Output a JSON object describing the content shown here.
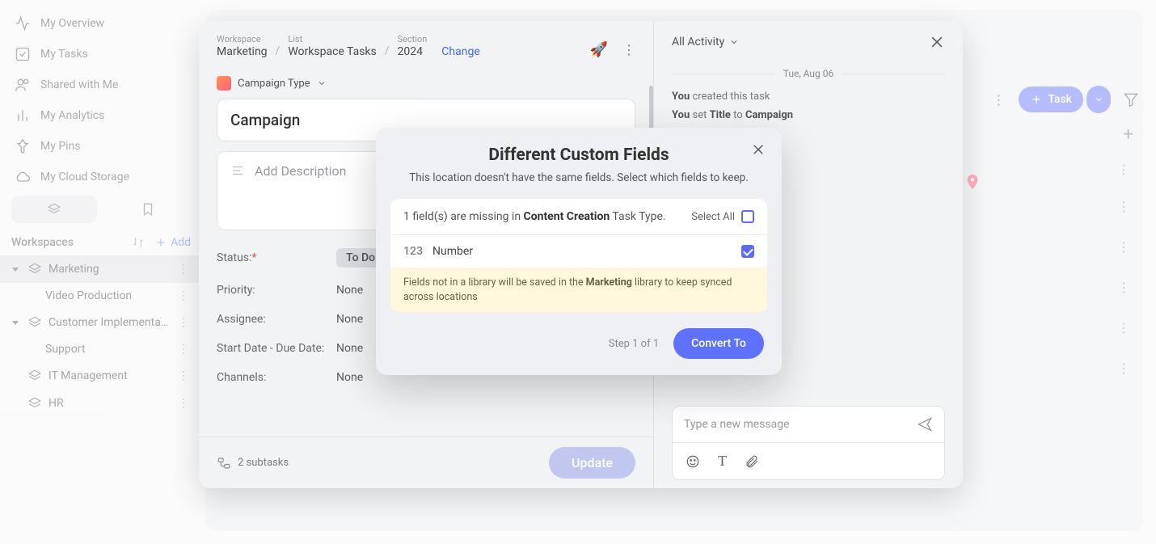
{
  "sidebar": {
    "nav": [
      {
        "label": "My Overview",
        "icon": "activity"
      },
      {
        "label": "My Tasks",
        "icon": "check-square"
      },
      {
        "label": "Shared with Me",
        "icon": "users"
      },
      {
        "label": "My Analytics",
        "icon": "bar-chart"
      },
      {
        "label": "My Pins",
        "icon": "pin"
      },
      {
        "label": "My Cloud Storage",
        "icon": "cloud"
      }
    ],
    "ws_label": "Workspaces",
    "add_label": "Add",
    "tree": [
      {
        "label": "Marketing",
        "active": true,
        "children": [
          {
            "label": "Video Production"
          }
        ]
      },
      {
        "label": "Customer Implementa…",
        "children": [
          {
            "label": "Support"
          }
        ]
      },
      {
        "label": "IT Management"
      },
      {
        "label": "HR"
      }
    ]
  },
  "board": {
    "task_btn": "Task"
  },
  "drawer": {
    "breadcrumb": {
      "workspace_lab": "Workspace",
      "workspace": "Marketing",
      "list_lab": "List",
      "list": "Workspace Tasks",
      "section_lab": "Section",
      "section": "2024",
      "change": "Change"
    },
    "task_type": "Campaign Type",
    "title": "Campaign",
    "desc_placeholder": "Add Description",
    "fields": {
      "status_lab": "Status:",
      "status_val": "To Do",
      "priority_lab": "Priority:",
      "priority_val": "None",
      "assignee_lab": "Assignee:",
      "assignee_val": "None",
      "dates_lab": "Start Date - Due Date:",
      "dates_val": "None",
      "channels_lab": "Channels:",
      "channels_val": "None"
    },
    "subtasks": "2 subtasks",
    "update": "Update",
    "activity": {
      "filter": "All Activity",
      "date": "Tue, Aug 06",
      "rows": [
        {
          "who": "You",
          "text": " created this task"
        },
        {
          "who": "You",
          "text": " set ",
          "b": "Title",
          "text2": " to ",
          "b2": "Campaign"
        }
      ],
      "placeholder": "Type a new message"
    }
  },
  "dialog": {
    "title": "Different Custom Fields",
    "sub": "This location doesn't have the same fields. Select which fields to keep.",
    "missing_pre": "1 field(s) are missing in ",
    "missing_type": "Content Creation",
    "missing_post": " Task Type.",
    "select_all": "Select All",
    "field_type": "123",
    "field_name": "Number",
    "note_pre": "Fields not in a library will be saved in the ",
    "note_lib": "Marketing",
    "note_post": " library to keep synced across locations",
    "step": "Step 1 of 1",
    "convert": "Convert To"
  }
}
